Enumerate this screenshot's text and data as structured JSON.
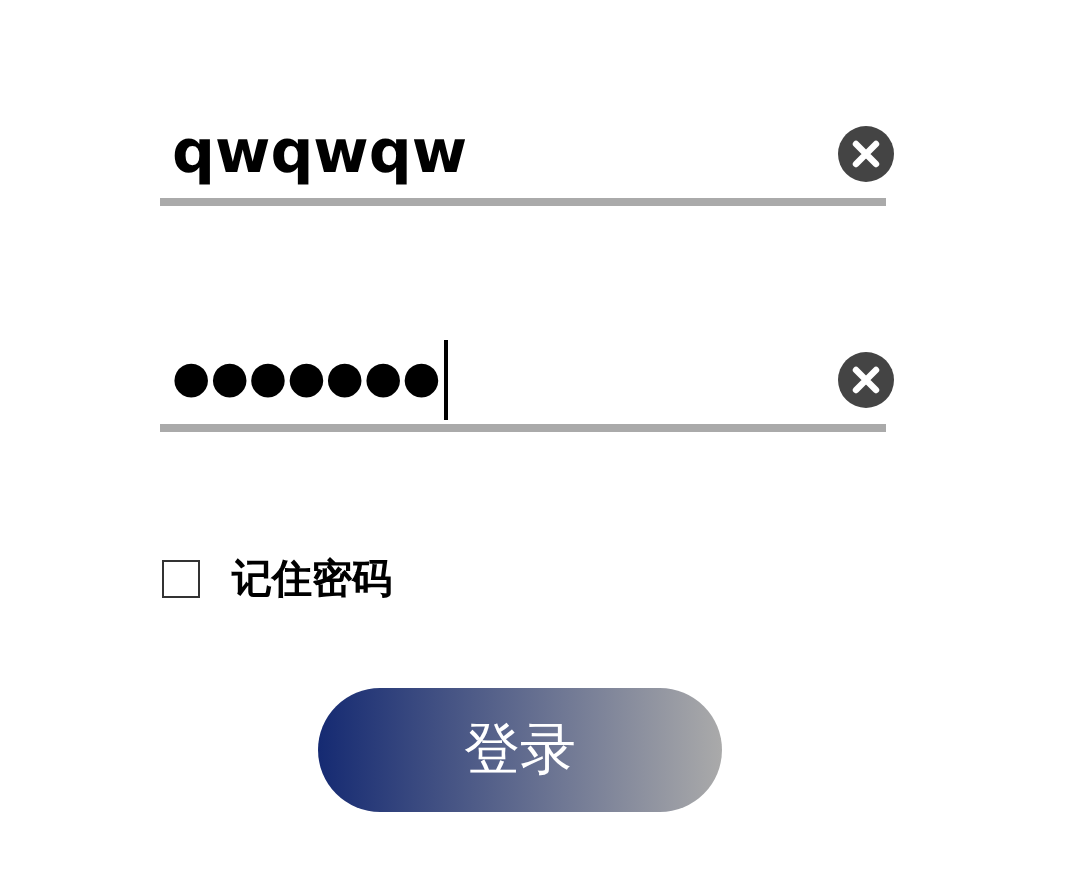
{
  "fields": [
    {
      "kind": "text",
      "value": "qwqwqw",
      "focused": false
    },
    {
      "kind": "password",
      "value": "●●●●●●●",
      "focused": true
    }
  ],
  "remember": {
    "label": "记住密码",
    "checked": false
  },
  "login_button": {
    "label": "登录"
  }
}
